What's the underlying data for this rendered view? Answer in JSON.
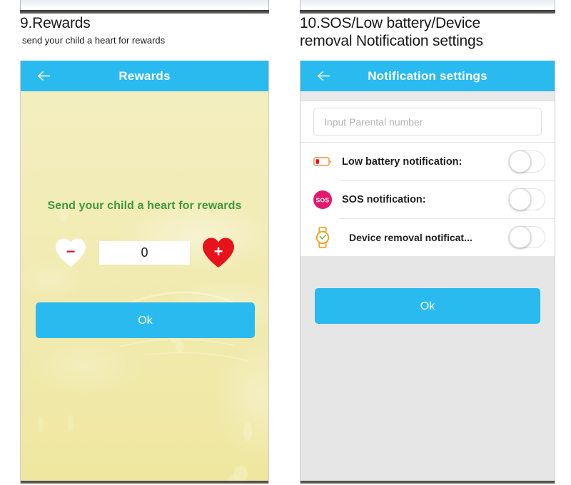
{
  "left_section": {
    "caption_title": "9.Rewards",
    "caption_subtitle": "send your child a heart for rewards",
    "appbar": {
      "title": "Rewards",
      "back_icon": "back-arrow-icon"
    },
    "headline": "Send your child a heart for rewards",
    "decrement": {
      "icon": "white-heart-minus-icon",
      "sign": "−"
    },
    "increment": {
      "icon": "red-heart-plus-icon",
      "sign": "+"
    },
    "count_value": "0",
    "count_placeholder": "0",
    "ok_label": "Ok"
  },
  "right_section": {
    "caption_title": "10.SOS/Low battery/Device\nremoval Notification settings",
    "appbar": {
      "title": "Notification settings",
      "back_icon": "back-arrow-icon"
    },
    "parental_number": {
      "value": "",
      "placeholder": "Input Parental number"
    },
    "rows": [
      {
        "icon": "low-battery-icon",
        "label": "Low battery notification:",
        "toggle_state": "off"
      },
      {
        "icon": "sos-icon",
        "label": "SOS notification:",
        "toggle_state": "off"
      },
      {
        "icon": "watch-icon",
        "label": "Device removal notificat...",
        "toggle_state": "off"
      }
    ],
    "ok_label": "Ok"
  },
  "colors": {
    "appbar_blue": "#29bbef",
    "button_blue": "#29bbef",
    "reward_background": "#f1ecb8",
    "headline_green": "#3d9a3d",
    "heart_red": "#e8121a",
    "sos_pink": "#e3196e",
    "watch_orange": "#f5a11c",
    "panel_gray": "#e6e6e6"
  }
}
